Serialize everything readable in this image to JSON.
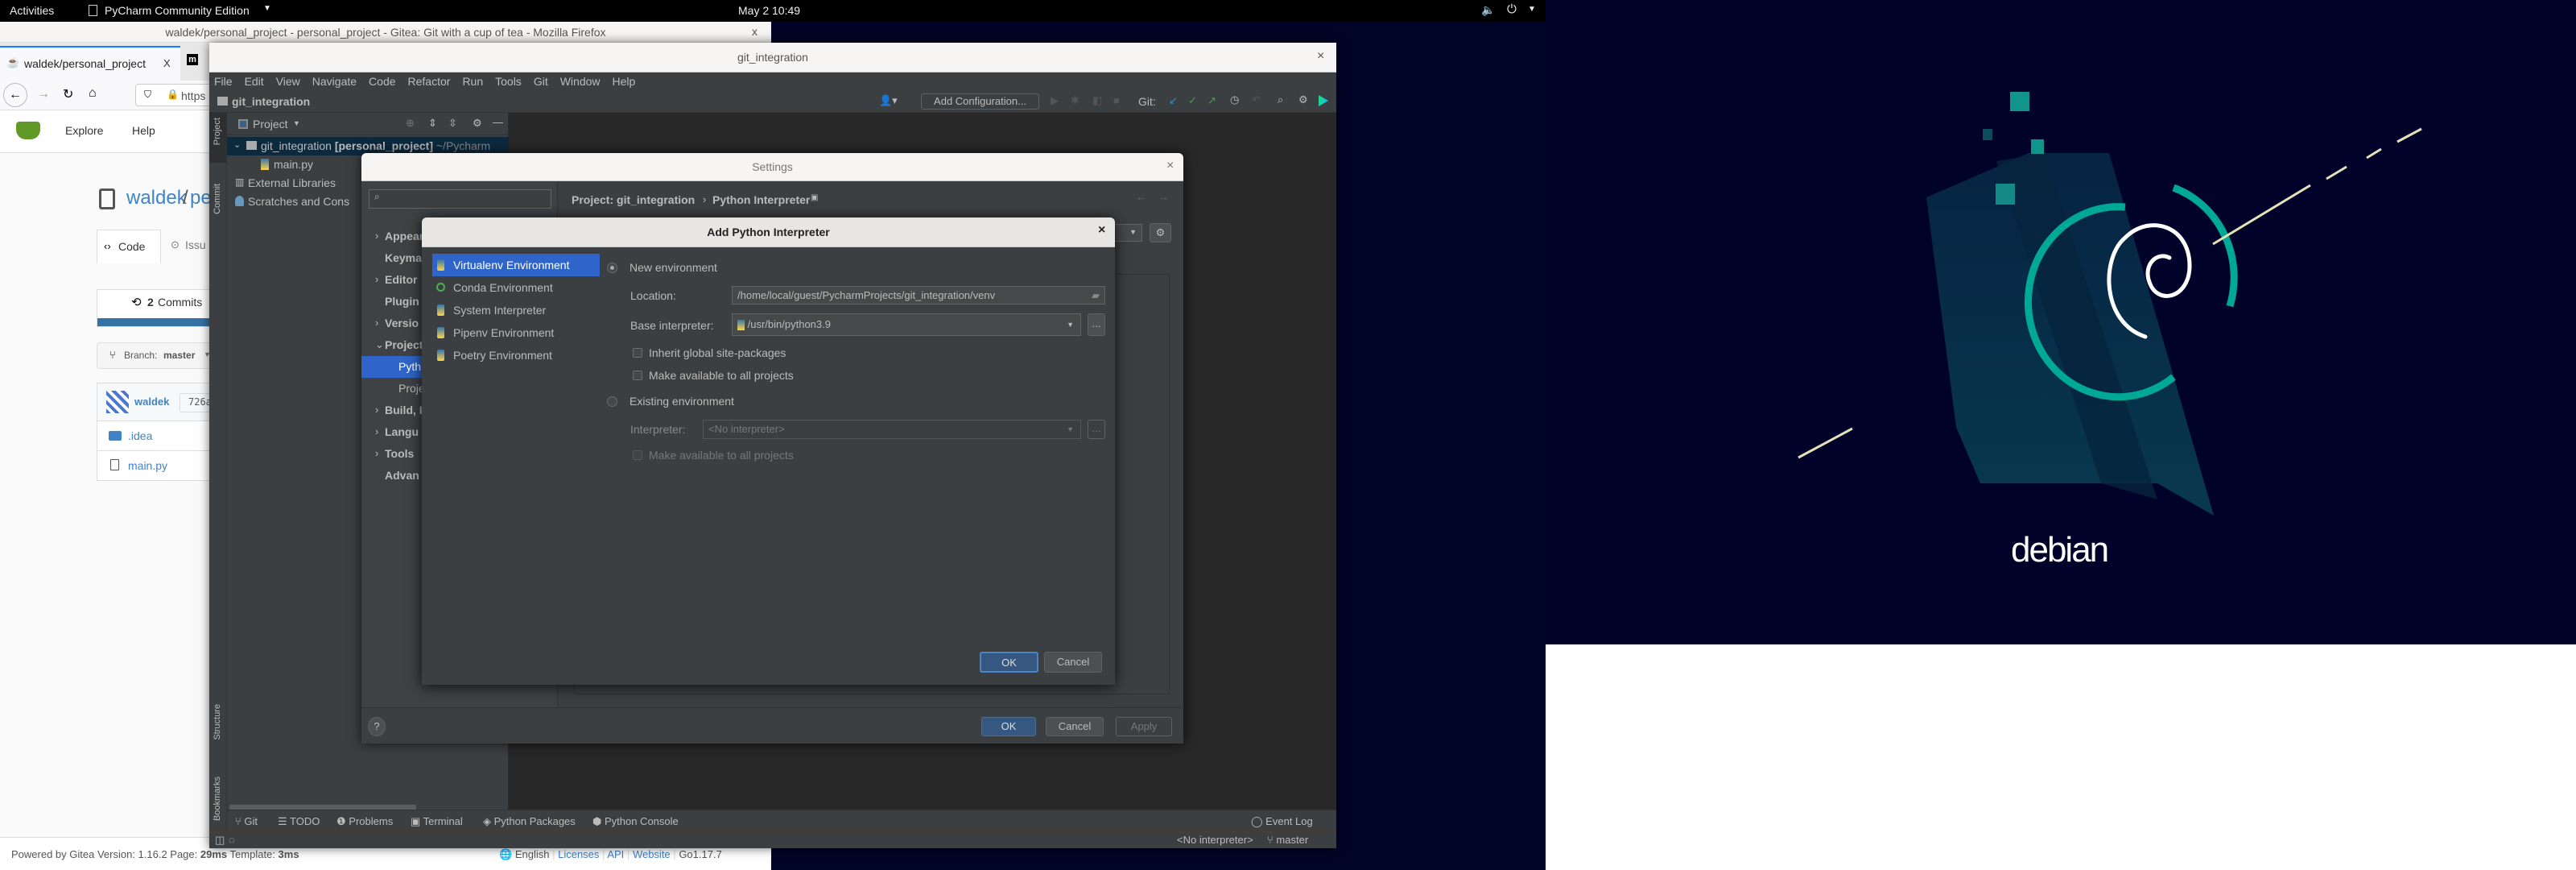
{
  "topbar": {
    "activities": "Activities",
    "app_menu": "PyCharm Community Edition",
    "clock": "May 2  10:49"
  },
  "firefox": {
    "title": "waldek/personal_project - personal_project - Gitea: Git with a cup of tea - Mozilla Firefox",
    "close": "x",
    "tabs": [
      {
        "label": "waldek/personal_project",
        "close": "X"
      }
    ],
    "url": "https",
    "gitea": {
      "nav": [
        "Explore",
        "Help"
      ],
      "owner": "waldek",
      "sep": "/",
      "repo": "pe",
      "tabs": [
        "Code",
        "Issu"
      ],
      "commits_count": "2",
      "commits_label": "Commits",
      "branch_label": "Branch:",
      "branch": "master",
      "commit_author": "waldek",
      "commit_hash": "726a",
      "files": [
        ".idea",
        "main.py"
      ],
      "footer": {
        "powered": "Powered by Gitea Version: 1.16.2 Page:",
        "page_time": "29ms",
        "template_label": "Template:",
        "template_time": "3ms",
        "language": "English",
        "links": [
          "Licenses",
          "API",
          "Website"
        ],
        "go_version": "Go1.17.7"
      }
    }
  },
  "pycharm": {
    "title": "git_integration",
    "close": "×",
    "menu": [
      "File",
      "Edit",
      "View",
      "Navigate",
      "Code",
      "Refactor",
      "Run",
      "Tools",
      "Git",
      "Window",
      "Help"
    ],
    "nav_project": "git_integration",
    "add_config": "Add Configuration...",
    "git_label": "Git:",
    "stripe": [
      "Project",
      "Commit",
      "Structure",
      "Bookmarks"
    ],
    "project_panel": {
      "title": "Project",
      "tree": {
        "root": "git_integration",
        "root_module": "[personal_project]",
        "root_path": "~/Pycharm",
        "file": "main.py",
        "ext_libs": "External Libraries",
        "scratches": "Scratches and Cons"
      }
    },
    "tool_windows": [
      "Git",
      "TODO",
      "Problems",
      "Terminal",
      "Python Packages",
      "Python Console"
    ],
    "event_log": "Event Log",
    "status": {
      "interpreter": "<No interpreter>",
      "branch": "master"
    }
  },
  "settings": {
    "title": "Settings",
    "close": "×",
    "breadcrumb": [
      "Project: git_integration",
      "Python Interpreter"
    ],
    "tree": [
      {
        "label": "Appear",
        "arrow": "›"
      },
      {
        "label": "Keyma",
        "arrow": ""
      },
      {
        "label": "Editor",
        "arrow": "›"
      },
      {
        "label": "Plugin",
        "arrow": ""
      },
      {
        "label": "Versio",
        "arrow": "›"
      },
      {
        "label": "Project",
        "arrow": "⌄"
      },
      {
        "label": "Pyth",
        "arrow": "",
        "selected": true,
        "child": true
      },
      {
        "label": "Proje",
        "arrow": "",
        "child": true
      },
      {
        "label": "Build, I",
        "arrow": "›"
      },
      {
        "label": "Langu",
        "arrow": "›"
      },
      {
        "label": "Tools",
        "arrow": "›"
      },
      {
        "label": "Advan",
        "arrow": ""
      }
    ],
    "help": "?",
    "ok": "OK",
    "cancel": "Cancel",
    "apply": "Apply"
  },
  "add_interpreter": {
    "title": "Add Python Interpreter",
    "close": "×",
    "env_types": [
      {
        "label": "Virtualenv Environment",
        "selected": true
      },
      {
        "label": "Conda Environment"
      },
      {
        "label": "System Interpreter"
      },
      {
        "label": "Pipenv Environment"
      },
      {
        "label": "Poetry Environment"
      }
    ],
    "new_env": "New environment",
    "location_label": "Location:",
    "location": "/home/local/guest/PycharmProjects/git_integration/venv",
    "base_label": "Base interpreter:",
    "base": "/usr/bin/python3.9",
    "browse": "...",
    "inherit": "Inherit global site-packages",
    "make_available": "Make available to all projects",
    "existing_env": "Existing environment",
    "interp_label": "Interpreter:",
    "interp_placeholder": "<No interpreter>",
    "make_available2": "Make available to all projects",
    "ok": "OK",
    "cancel": "Cancel"
  },
  "desktop": {
    "logo_text": "debian"
  },
  "colors": {
    "selection": "#2f65ca",
    "darcula_bg": "#3c3f41",
    "editor_bg": "#282828",
    "wallpaper": "#000229",
    "teal": "#00a896",
    "gitea_link": "#4183c4"
  }
}
